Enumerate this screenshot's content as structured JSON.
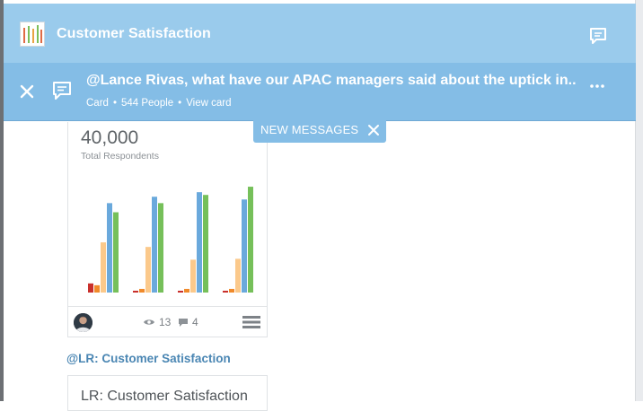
{
  "header": {
    "title": "Customer Satisfaction",
    "logo_icon": "bar-chart-logo-icon",
    "chat_icon": "speech-bubble-icon",
    "bg_color": "#9acbec"
  },
  "notification": {
    "headline": "@Lance Rivas, what have our APAC managers said about the uptick in..",
    "meta": {
      "type": "Card",
      "people": "544 People",
      "link": "View card"
    },
    "more_label": "•••",
    "bg_color": "#84bde6"
  },
  "new_messages": {
    "label": "NEW MESSAGES"
  },
  "card": {
    "big_number": "40,000",
    "subtitle": "Total Respondents",
    "views": "13",
    "comments": "4"
  },
  "chart_data": {
    "type": "bar",
    "groups": 4,
    "series": [
      {
        "color": "#c9302c",
        "values": [
          10,
          2,
          2,
          2
        ]
      },
      {
        "color": "#f08a2b",
        "values": [
          8,
          4,
          4,
          4
        ]
      },
      {
        "color": "#fbc98b",
        "values": [
          55,
          50,
          36,
          37
        ]
      },
      {
        "color": "#6aa9dc",
        "values": [
          98,
          105,
          110,
          102
        ]
      },
      {
        "color": "#76c05a",
        "values": [
          88,
          98,
          107,
          116
        ]
      }
    ],
    "ylim": [
      0,
      120
    ]
  },
  "link_title": "@LR: Customer Satisfaction",
  "card2": {
    "title": "LR: Customer Satisfaction"
  }
}
